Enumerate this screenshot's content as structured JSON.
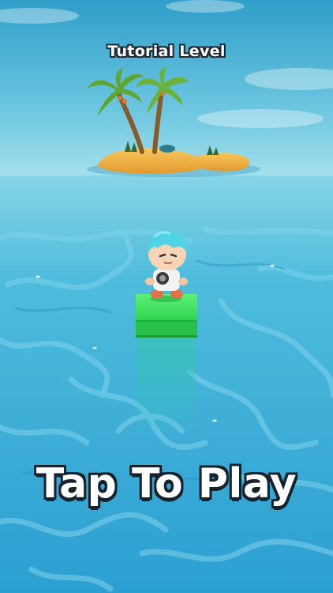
{
  "hud": {
    "level_title": "Tutorial Level",
    "tap_prompt": "Tap To Play"
  },
  "colors": {
    "sky_top": "#2f9ec9",
    "sky_bottom": "#8fd8ea",
    "sea_horizon": "#7fd0e4",
    "sea_deep": "#2a9ed0",
    "sand": "#f3b44a",
    "block_green": "#36e05a",
    "character_hair": "#4fd3e6"
  },
  "icons": {
    "island": "palm-island",
    "player": "character-on-block"
  }
}
